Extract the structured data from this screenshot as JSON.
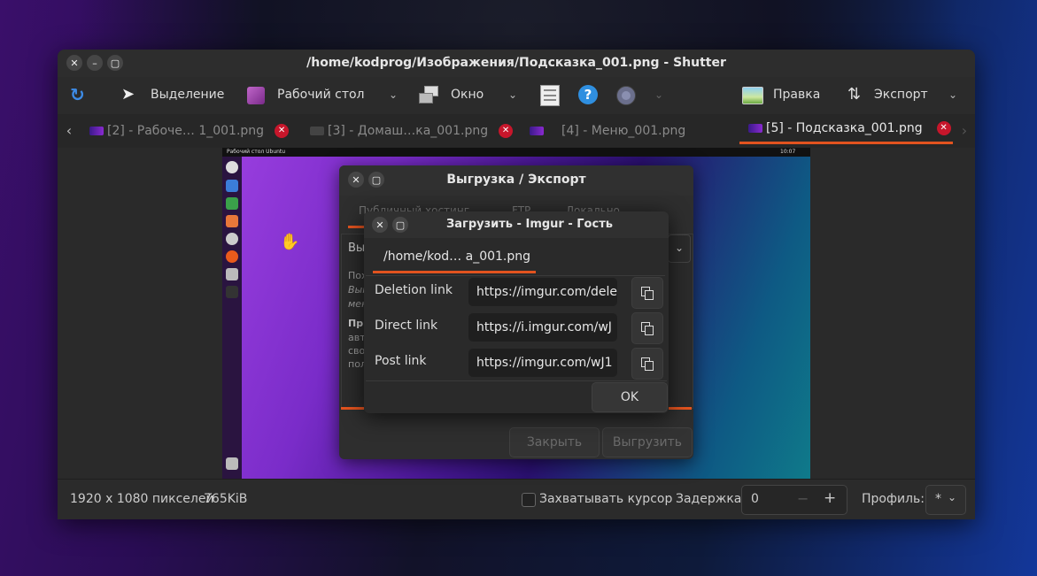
{
  "window": {
    "title": "/home/kodprog/Изображения/Подсказка_001.png - Shutter"
  },
  "toolbar": {
    "selection_label": "Выделение",
    "desktop_label": "Рабочий стол",
    "window_label": "Окно",
    "edit_label": "Правка",
    "export_label": "Экспорт"
  },
  "tabs": [
    {
      "label": "[2] - Рабоче… 1_001.png",
      "closable": true
    },
    {
      "label": "[3] - Домаш…ка_001.png",
      "closable": true
    },
    {
      "label": "[4] - Меню_001.png",
      "closable": false
    },
    {
      "label": "[5] - Подсказка_001.png",
      "closable": true,
      "active": true
    }
  ],
  "preview": {
    "topbar_text": "Рабочий стол Ubuntu",
    "clock": "10:07"
  },
  "export_dialog": {
    "title": "Выгрузка / Экспорт",
    "tab_fragments": [
      "Публичный хостинг",
      "FTP",
      "Локально"
    ],
    "side_text": [
      "Вы",
      "Пох",
      "Выг",
      "мен",
      "При",
      "авт",
      "сво",
      "пол"
    ],
    "close_button": "Закрыть",
    "upload_button": "Выгрузить"
  },
  "imgur_dialog": {
    "title": "Загрузить - Imgur - Гость",
    "file_tab": "/home/kod… a_001.png",
    "rows": [
      {
        "label": "Deletion link",
        "value": "https://imgur.com/dele"
      },
      {
        "label": "Direct link",
        "value": "https://i.imgur.com/wJ"
      },
      {
        "label": "Post link",
        "value": "https://imgur.com/wJ1"
      }
    ],
    "ok_button": "OK"
  },
  "status": {
    "dimensions": "1920 x 1080 пикселей",
    "size": "765KiB",
    "capture_cursor_label": "Захватывать курсор",
    "delay_label": "Задержка:",
    "delay_value": "0",
    "profile_label": "Профиль:",
    "profile_value": "*"
  },
  "colors": {
    "accent": "#e2531f",
    "close_red": "#c7162b",
    "help_blue": "#2f8fe0"
  }
}
